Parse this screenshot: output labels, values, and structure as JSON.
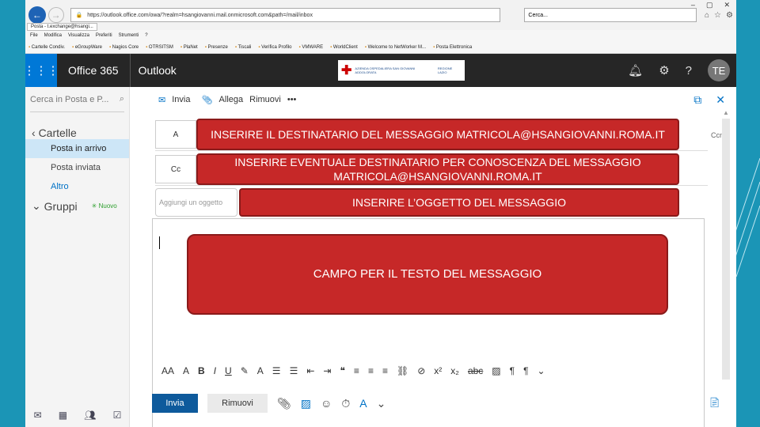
{
  "browser": {
    "url": "https://outlook.office.com/owa/?realm=hsangiovanni.mail.onmicrosoft.com&path=/mail/inbox",
    "search_placeholder": "Cerca...",
    "tab_title": "Posta - t.exchange@hsangi...",
    "menu": [
      "File",
      "Modifica",
      "Visualizza",
      "Preferiti",
      "Strumenti",
      "?"
    ],
    "favorites": [
      "Cartelle Condiv.",
      "eGroupWare",
      "Nagios Core",
      "OTRSITSM",
      "PlaNet",
      "Presenze",
      "Tiscali",
      "Verifica Profilo",
      "VMWARE",
      "WorldClient",
      "Welcome to NetWorker M...",
      "Posta Elettronica"
    ]
  },
  "suite": {
    "product": "Office 365",
    "app": "Outlook",
    "logo_left": "AZIENDA OSPEDALIERA SAN GIOVANNI ADDOLORATA",
    "logo_right": "REGIONE LAZIO",
    "avatar": "TE"
  },
  "nav": {
    "search_placeholder": "Cerca in Posta e P...",
    "folders_heading": "Cartelle",
    "items": [
      "Posta in arrivo",
      "Posta inviata",
      "Altro"
    ],
    "groups_heading": "Gruppi",
    "new_label": "Nuovo"
  },
  "compose": {
    "send_label": "Invia",
    "attach_label": "Allega",
    "discard_label": "Rimuovi",
    "more_label": "•••",
    "to_label": "A",
    "cc_label": "Cc",
    "bcc_label": "Ccn",
    "subject_placeholder": "Aggiungi un oggetto",
    "send_button": "Invia",
    "discard_button": "Rimuovi"
  },
  "callouts": {
    "to": "INSERIRE IL DESTINATARIO DEL MESSAGGIO MATRICOLA@HSANGIOVANNI.ROMA.IT",
    "cc": "INSERIRE EVENTUALE DESTINATARIO PER CONOSCENZA DEL MESSAGGIO MATRICOLA@HSANGIOVANNI.ROMA.IT",
    "subject": "INSERIRE L’OGGETTO DEL MESSAGGIO",
    "body": "CAMPO PER IL TESTO DEL MESSAGGIO"
  }
}
